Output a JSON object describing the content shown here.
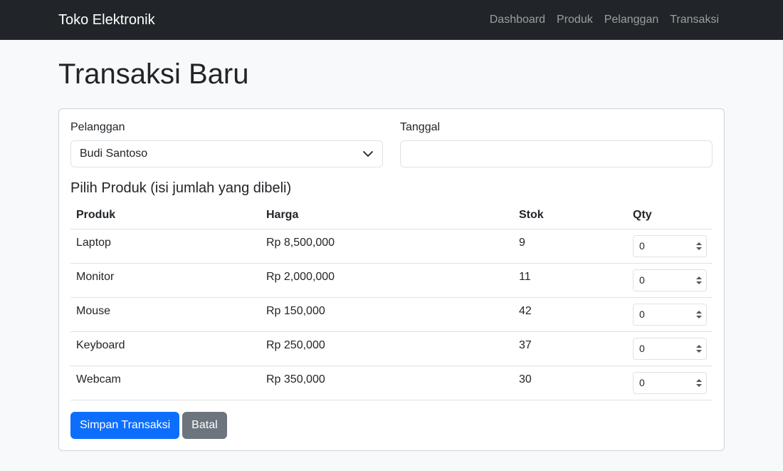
{
  "navbar": {
    "brand": "Toko Elektronik",
    "links": [
      "Dashboard",
      "Produk",
      "Pelanggan",
      "Transaksi"
    ]
  },
  "page": {
    "title": "Transaksi Baru"
  },
  "form": {
    "customer_label": "Pelanggan",
    "customer_selected": "Budi Santoso",
    "date_label": "Tanggal",
    "date_value": "",
    "products_heading": "Pilih Produk (isi jumlah yang dibeli)"
  },
  "table": {
    "headers": [
      "Produk",
      "Harga",
      "Stok",
      "Qty"
    ],
    "rows": [
      {
        "name": "Laptop",
        "price": "Rp 8,500,000",
        "stock": "9",
        "qty": "0"
      },
      {
        "name": "Monitor",
        "price": "Rp 2,000,000",
        "stock": "11",
        "qty": "0"
      },
      {
        "name": "Mouse",
        "price": "Rp 150,000",
        "stock": "42",
        "qty": "0"
      },
      {
        "name": "Keyboard",
        "price": "Rp 250,000",
        "stock": "37",
        "qty": "0"
      },
      {
        "name": "Webcam",
        "price": "Rp 350,000",
        "stock": "30",
        "qty": "0"
      }
    ]
  },
  "actions": {
    "save": "Simpan Transaksi",
    "cancel": "Batal"
  },
  "colors": {
    "navbar": "#212529",
    "primary": "#0d6efd",
    "secondary": "#6c757d"
  }
}
